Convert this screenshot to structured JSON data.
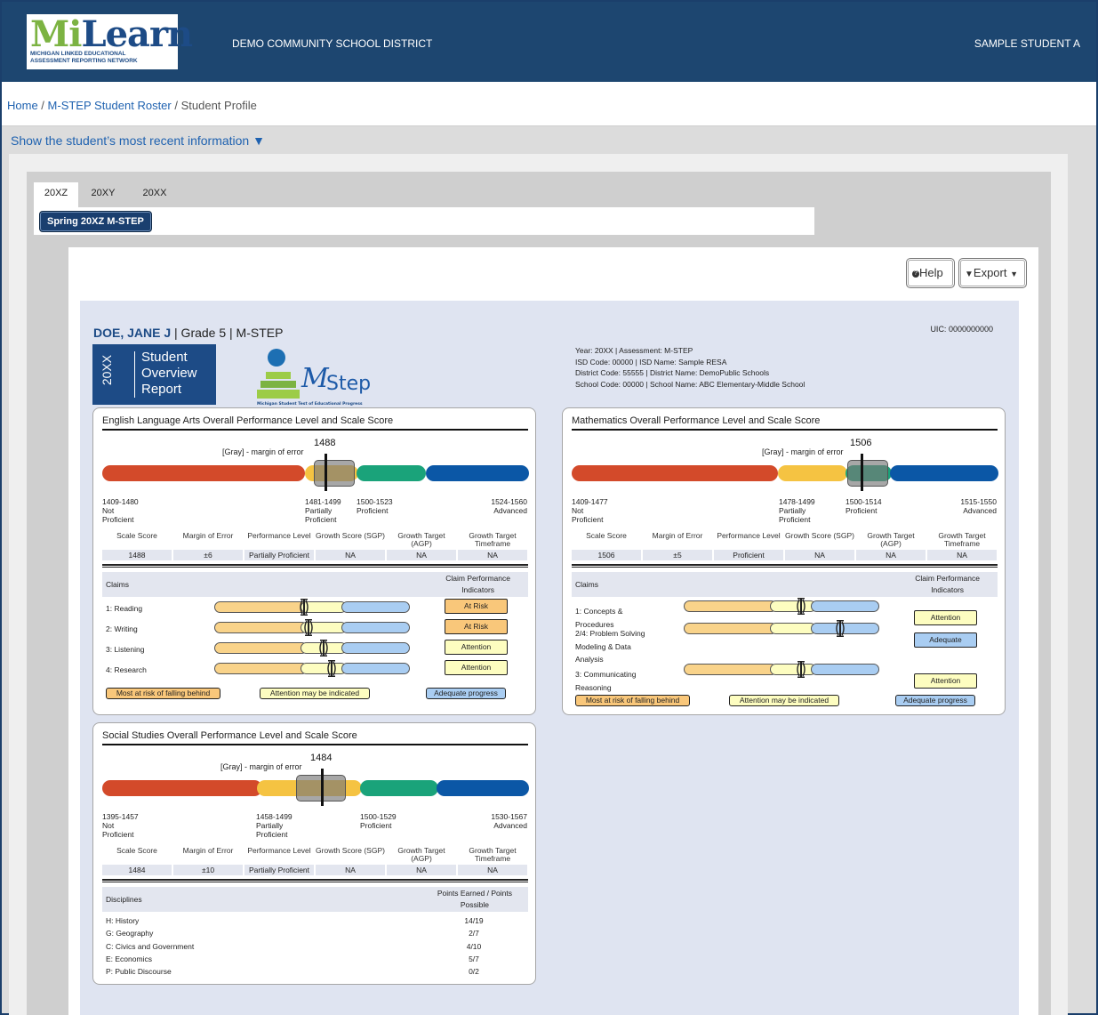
{
  "header": {
    "logo_main": "MiLearn",
    "logo_sub_1": "MICHIGAN LINKED EDUCATIONAL",
    "logo_sub_2": "ASSESSMENT REPORTING NETWORK",
    "district": "DEMO COMMUNITY SCHOOL DISTRICT",
    "student": "SAMPLE STUDENT A"
  },
  "breadcrumb": {
    "home": "Home",
    "sep": " / ",
    "roster": "M-STEP Student Roster",
    "current": "Student Profile"
  },
  "toggle": "Show the student’s most recent information ▼",
  "tabs": [
    "20XZ",
    "20XY",
    "20XX"
  ],
  "assessment_button": "Spring 20XZ M-STEP",
  "toolbar": {
    "help": "Help",
    "export": "Export"
  },
  "report": {
    "student_name": "DOE, JANE J",
    "grade_line": " | Grade 5 | M-STEP",
    "uic": "UIC: 0000000000",
    "badge_year": "20XX",
    "badge_title_1": "Student",
    "badge_title_2": "Overview",
    "badge_title_3": "Report",
    "mstep_logo": "M-Step",
    "mstep_tagline": "Michigan Student Test of Educational Progress",
    "meta": [
      "Year: 20XX | Assessment: M-STEP",
      "ISD Code: 00000 | ISD Name: Sample RESA",
      "District Code: 55555 | District Name: DemoPublic Schools",
      "School Code: 00000 | School Name: ABC Elementary-Middle School"
    ]
  },
  "score_headers": [
    "Scale Score",
    "Margin of Error",
    "Performance Level",
    "Growth Score (SGP)",
    "Growth Target (AGP)",
    "Growth Target Timeframe"
  ],
  "moe_label": "[Gray] - margin of error",
  "ela": {
    "title": "English Language Arts Overall Performance Level and Scale Score",
    "score": "1488",
    "ranges": [
      {
        "range": "1409-1480",
        "level": "Not Proficient"
      },
      {
        "range": "1481-1499",
        "level": "Partially Proficient"
      },
      {
        "range": "1500-1523",
        "level": "Proficient"
      },
      {
        "range": "1524-1560",
        "level": "Advanced"
      }
    ],
    "values": [
      "1488",
      "±6",
      "Partially Proficient",
      "NA",
      "NA",
      "NA"
    ],
    "claims_header": "Claims",
    "indicators_header_1": "Claim Performance",
    "indicators_header_2": "Indicators",
    "claims": [
      {
        "name": "1: Reading",
        "indicator": "At Risk",
        "level": "risk",
        "mark": 0.46
      },
      {
        "name": "2: Writing",
        "indicator": "At Risk",
        "level": "risk",
        "mark": 0.48
      },
      {
        "name": "3: Listening",
        "indicator": "Attention",
        "level": "attention",
        "mark": 0.56
      },
      {
        "name": "4: Research",
        "indicator": "Attention",
        "level": "attention",
        "mark": 0.6
      }
    ]
  },
  "math": {
    "title": "Mathematics Overall Performance Level and Scale Score",
    "score": "1506",
    "ranges": [
      {
        "range": "1409-1477",
        "level": "Not Proficient"
      },
      {
        "range": "1478-1499",
        "level": "Partially Proficient"
      },
      {
        "range": "1500-1514",
        "level": "Proficient"
      },
      {
        "range": "1515-1550",
        "level": "Advanced"
      }
    ],
    "values": [
      "1506",
      "±5",
      "Proficient",
      "NA",
      "NA",
      "NA"
    ],
    "claims_header": "Claims",
    "indicators_header_1": "Claim Performance",
    "indicators_header_2": "Indicators",
    "claims": [
      {
        "name_1": "1: Concepts &",
        "name_2": "Procedures",
        "name_3": "",
        "indicator": "Attention",
        "level": "attention",
        "mark": 0.6
      },
      {
        "name_1": "2/4: Problem Solving",
        "name_2": "Modeling & Data",
        "name_3": "Analysis",
        "indicator": "Adequate",
        "level": "adequate",
        "mark": 0.8
      },
      {
        "name_1": "3: Communicating",
        "name_2": "Reasoning",
        "name_3": "",
        "indicator": "Attention",
        "level": "attention",
        "mark": 0.6
      }
    ]
  },
  "legend": {
    "risk": "Most at risk  of falling behind",
    "attention": "Attention  may be indicated",
    "adequate": "Adequate  progress"
  },
  "ss": {
    "title": "Social Studies Overall Performance Level and Scale Score",
    "score": "1484",
    "ranges": [
      {
        "range": "1395-1457",
        "level": "Not Proficient"
      },
      {
        "range": "1458-1499",
        "level": "Partially Proficient"
      },
      {
        "range": "1500-1529",
        "level": "Proficient"
      },
      {
        "range": "1530-1567",
        "level": "Advanced"
      }
    ],
    "values": [
      "1484",
      "±10",
      "Partially Proficient",
      "NA",
      "NA",
      "NA"
    ],
    "disc_header": "Disciplines",
    "points_header_1": "Points Earned / Points",
    "points_header_2": "Possible",
    "disciplines": [
      {
        "name": "H: History",
        "points": "14/19"
      },
      {
        "name": "G: Geography",
        "points": "2/7"
      },
      {
        "name": "C: Civics and Government",
        "points": "4/10"
      },
      {
        "name": "E: Economics",
        "points": "5/7"
      },
      {
        "name": "P: Public Discourse",
        "points": "0/2"
      }
    ]
  },
  "colors": {
    "not_proficient": "#d34a2a",
    "partially": "#f5c342",
    "proficient": "#1aa37a",
    "advanced": "#0b57a6",
    "claim_low": "#f9d38a",
    "claim_mid": "#fdfdc0",
    "claim_high": "#a9cdf2",
    "risk": "#f9c77a",
    "attention": "#fdfdc0",
    "adequate": "#a9cdf2",
    "header_bg": "#1d4670"
  }
}
